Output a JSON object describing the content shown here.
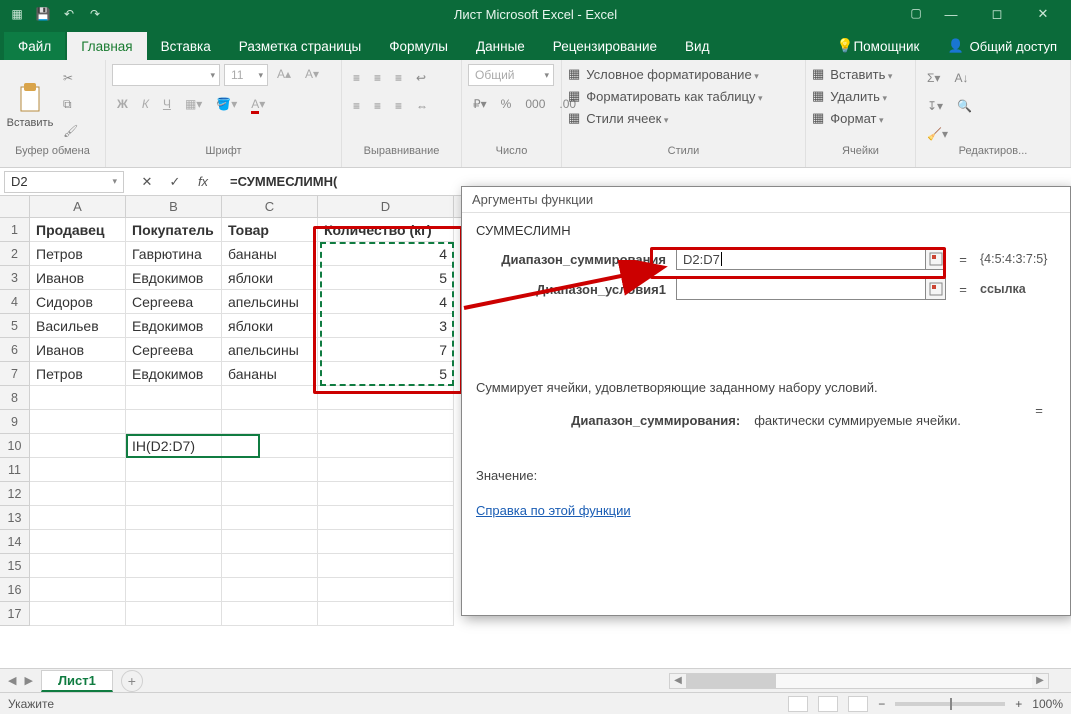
{
  "title": "Лист Microsoft Excel - Excel",
  "tabs": {
    "file": "Файл",
    "home": "Главная",
    "insert": "Вставка",
    "layout": "Разметка страницы",
    "formulas": "Формулы",
    "data": "Данные",
    "review": "Рецензирование",
    "view": "Вид",
    "help": "Помощник",
    "share": "Общий доступ"
  },
  "ribbon": {
    "clipboard": {
      "paste": "Вставить",
      "label": "Буфер обмена"
    },
    "font": {
      "label": "Шрифт",
      "size": "11"
    },
    "align": {
      "label": "Выравнивание"
    },
    "number": {
      "label": "Число",
      "format": "Общий"
    },
    "styles": {
      "label": "Стили",
      "cf": "Условное форматирование",
      "table": "Форматировать как таблицу",
      "cell": "Стили ячеек"
    },
    "cells": {
      "label": "Ячейки",
      "insert": "Вставить",
      "delete": "Удалить",
      "format": "Формат"
    },
    "edit": {
      "label": "Редактиров..."
    }
  },
  "namebox": "D2",
  "fx": "=СУММЕСЛИМН(",
  "columns": [
    "A",
    "B",
    "C",
    "D"
  ],
  "headers": {
    "A": "Продавец",
    "B": "Покупатель",
    "C": "Товар",
    "D": "Количество (кг)"
  },
  "rows": [
    {
      "A": "Петров",
      "B": "Гаврютина",
      "C": "бананы",
      "D": "4"
    },
    {
      "A": "Иванов",
      "B": "Евдокимов",
      "C": "яблоки",
      "D": "5"
    },
    {
      "A": "Сидоров",
      "B": "Сергеева",
      "C": "апельсины",
      "D": "4"
    },
    {
      "A": "Васильев",
      "B": "Евдокимов",
      "C": "яблоки",
      "D": "3"
    },
    {
      "A": "Иванов",
      "B": "Сергеева",
      "C": "апельсины",
      "D": "7"
    },
    {
      "A": "Петров",
      "B": "Евдокимов",
      "C": "бананы",
      "D": "5"
    }
  ],
  "formula_cell": "ІН(D2:D7)",
  "sheet": "Лист1",
  "status": "Укажите",
  "zoom": "100%",
  "dialog": {
    "title": "Аргументы функции",
    "fn": "СУММЕСЛИМН",
    "arg1": {
      "label": "Диапазон_суммирования",
      "value": "D2:D7",
      "result": "{4:5:4:3:7:5}"
    },
    "arg2": {
      "label": "Диапазон_условия1",
      "value": "",
      "result": "ссылка"
    },
    "eq": "=",
    "desc1": "Суммирует ячейки, удовлетворяющие заданному набору условий.",
    "desc2k": "Диапазон_суммирования:",
    "desc2v": "фактически суммируемые ячейки.",
    "value_label": "Значение:",
    "help": "Справка по этой функции"
  }
}
